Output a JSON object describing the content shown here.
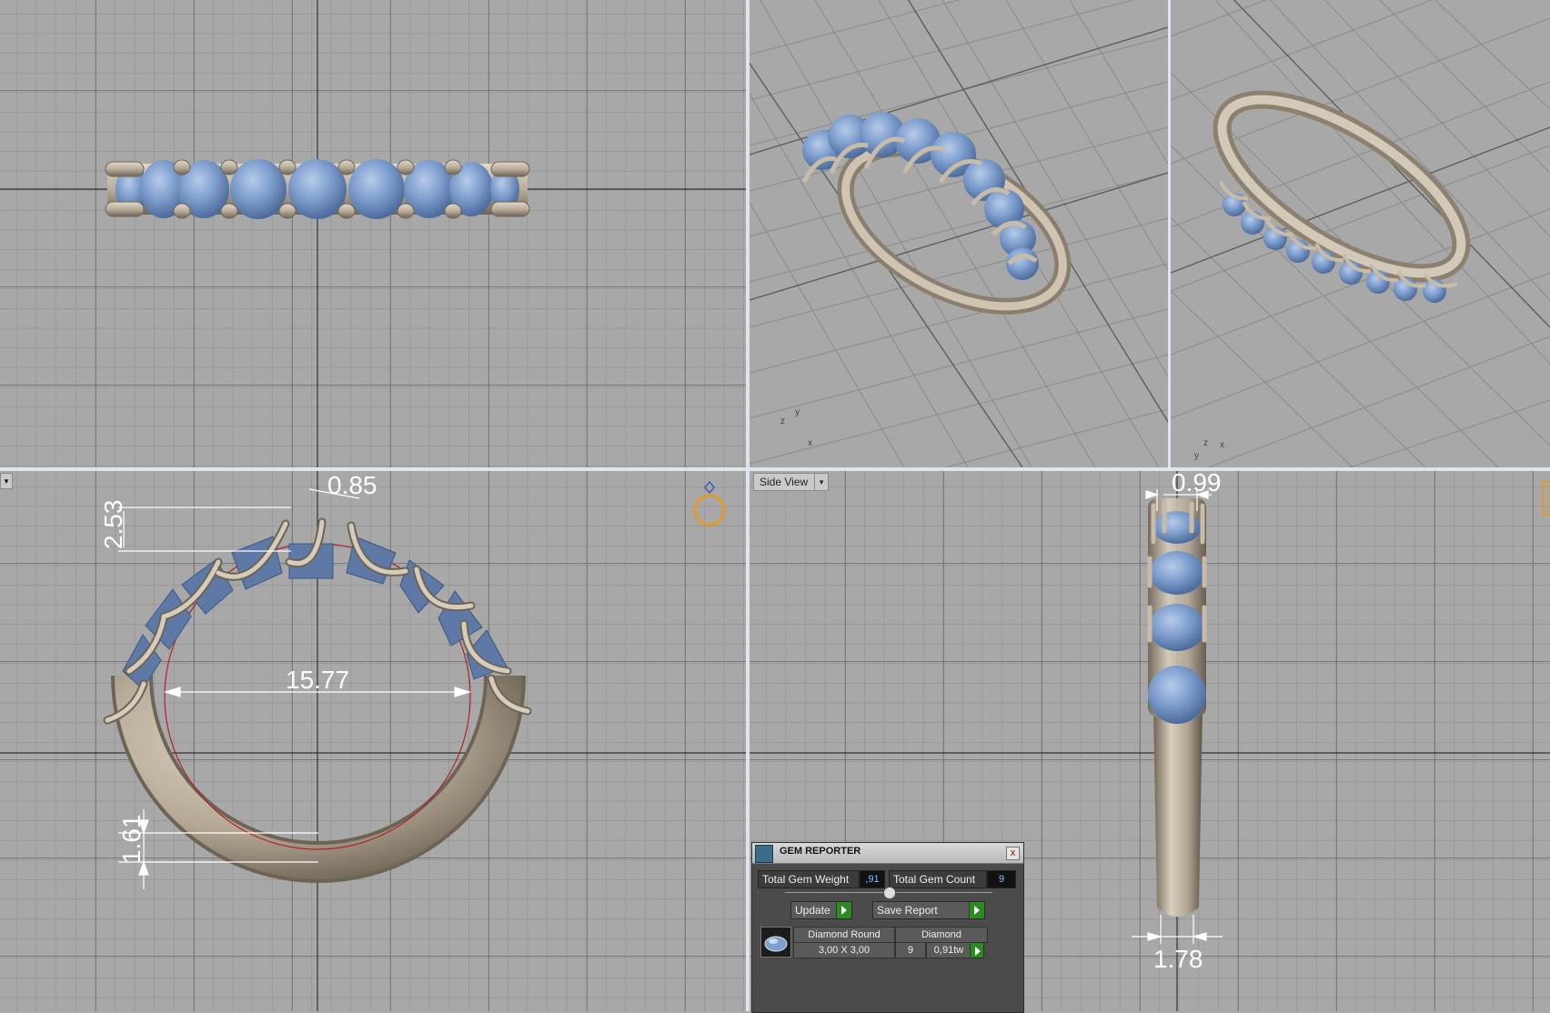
{
  "viewports": {
    "bottom_right_label": "Side View",
    "dropdown_glyph": "▾",
    "axis_top_right_a": [
      "z",
      "y",
      "x"
    ],
    "axis_top_right_b": [
      "z",
      "x",
      "y"
    ]
  },
  "dimensions": {
    "top_width": "0.85",
    "shank_top_height": "2.53",
    "inner_diameter": "15.77",
    "shank_bottom": "1.61",
    "side_top_width": "0.99",
    "side_bottom_width": "1.78"
  },
  "colors": {
    "metal": "#c0b4a3",
    "gem": "#7f9fcf",
    "grid_bg": "#a8a8a8",
    "inner_circle": "#b3202a"
  },
  "gem_reporter": {
    "title": "GEM REPORTER",
    "close_glyph": "x",
    "total_weight_label": "Total Gem Weight",
    "total_weight_value": ",91",
    "total_count_label": "Total Gem Count",
    "total_count_value": "9",
    "update_label": "Update",
    "save_label": "Save Report",
    "row": {
      "shape": "Diamond Round",
      "material": "Diamond",
      "size": "3,00 X 3,00",
      "count": "9",
      "weight": "0,91tw"
    }
  }
}
